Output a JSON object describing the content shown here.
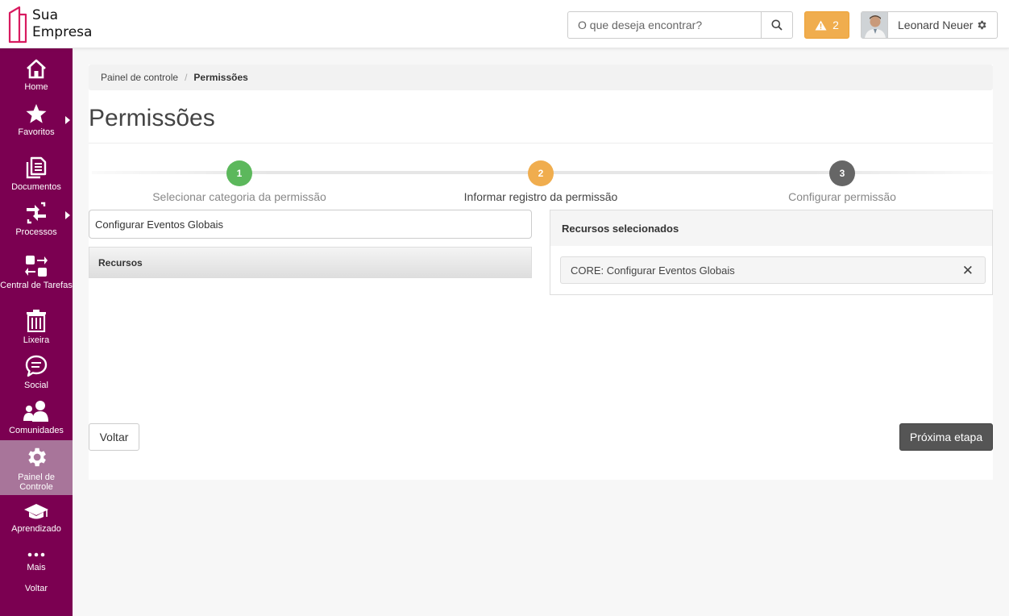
{
  "brand": {
    "line1": "Sua",
    "line2": "Empresa",
    "color": "#d81b60"
  },
  "header": {
    "search_placeholder": "O que deseja encontrar?",
    "alert_count": "2",
    "user_name": "Leonard Neuer"
  },
  "colors": {
    "sidebar": "#7b0051",
    "sidebar_active": "#a8759a",
    "warning": "#f0ad4e",
    "step_done": "#5cb85c",
    "step_current": "#f0ad4e",
    "step_pending": "#666666"
  },
  "sidebar": {
    "items": [
      {
        "label": "Home",
        "icon": "home-icon"
      },
      {
        "label": "Favoritos",
        "icon": "star-icon"
      },
      {
        "label": "Documentos",
        "icon": "documents-icon"
      },
      {
        "label": "Processos",
        "icon": "processes-icon"
      },
      {
        "label": "Central de Tarefas",
        "icon": "tasks-icon"
      },
      {
        "label": "Lixeira",
        "icon": "trash-icon"
      },
      {
        "label": "Social",
        "icon": "chat-icon"
      },
      {
        "label": "Comunidades",
        "icon": "communities-icon"
      },
      {
        "label": "Painel de Controle",
        "icon": "gear-icon",
        "active": true
      },
      {
        "label": "Aprendizado",
        "icon": "graduation-cap-icon"
      },
      {
        "label": "Mais",
        "icon": "more-icon"
      },
      {
        "label": "Voltar"
      }
    ]
  },
  "breadcrumb": {
    "root": "Painel de controle",
    "separator": "/",
    "current": "Permissões"
  },
  "page": {
    "title": "Permissões"
  },
  "steps": [
    {
      "number": "1",
      "label": "Selecionar categoria da permissão",
      "status": "done"
    },
    {
      "number": "2",
      "label": "Informar registro da permissão",
      "status": "current"
    },
    {
      "number": "3",
      "label": "Configurar permissão",
      "status": "pending"
    }
  ],
  "left_panel": {
    "input_value": "Configurar Eventos Globais",
    "resources_header": "Recursos"
  },
  "right_panel": {
    "header": "Recursos selecionados",
    "items": [
      "CORE: Configurar Eventos Globais"
    ],
    "remove_symbol": "✕"
  },
  "buttons": {
    "back": "Voltar",
    "next": "Próxima etapa"
  }
}
